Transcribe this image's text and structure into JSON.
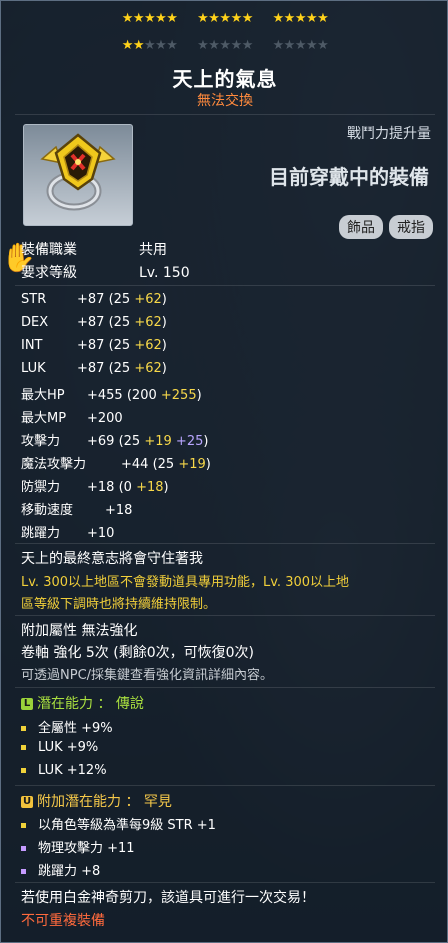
{
  "stars": {
    "row1": [
      "★★★★★",
      "★★★★★",
      "★★★★★"
    ],
    "row2_on": "★★",
    "row2_off_g1": "★★★",
    "row2_off_g2": "★★★★★",
    "row2_off_g3": "★★★★★"
  },
  "item": {
    "name": "天上的氣息",
    "tradeable": "無法交換",
    "power_label": "戰鬥力提升量",
    "wearing_label": "目前穿戴中的裝備",
    "tags": [
      "飾品",
      "戒指"
    ]
  },
  "requirements": [
    {
      "label": "裝備職業",
      "value": "共用"
    },
    {
      "label": "要求等級",
      "value": "Lv. 150"
    }
  ],
  "stats": [
    {
      "label": "STR",
      "total": "+87",
      "base": "(25",
      "bonus1": "+62",
      "bonus2": "",
      "close": ")"
    },
    {
      "label": "DEX",
      "total": "+87",
      "base": "(25",
      "bonus1": "+62",
      "bonus2": "",
      "close": ")"
    },
    {
      "label": "INT",
      "total": "+87",
      "base": "(25",
      "bonus1": "+62",
      "bonus2": "",
      "close": ")"
    },
    {
      "label": "LUK",
      "total": "+87",
      "base": "(25",
      "bonus1": "+62",
      "bonus2": "",
      "close": ")"
    },
    {
      "label": "最大HP",
      "total": "+455",
      "base": "(200",
      "bonus1": "+255",
      "bonus2": "",
      "close": ")"
    },
    {
      "label": "最大MP",
      "total": "+200",
      "base": "",
      "bonus1": "",
      "bonus2": "",
      "close": ""
    },
    {
      "label": "攻擊力",
      "total": "+69",
      "base": "(25",
      "bonus1": "+19",
      "bonus2": "+25",
      "close": ")"
    },
    {
      "label": "魔法攻擊力",
      "total": "+44",
      "base": "(25",
      "bonus1": "+19",
      "bonus2": "",
      "close": ")"
    },
    {
      "label": "防禦力",
      "total": "+18",
      "base": "(0",
      "bonus1": "+18",
      "bonus2": "",
      "close": ")"
    },
    {
      "label": "移動速度",
      "total": "+18",
      "base": "",
      "bonus1": "",
      "bonus2": "",
      "close": ""
    },
    {
      "label": "跳躍力",
      "total": "+10",
      "base": "",
      "bonus1": "",
      "bonus2": "",
      "close": ""
    }
  ],
  "description": {
    "line1": "天上的最終意志將會守住著我",
    "warn1": "Lv. 300以上地區不會發動道具專用功能，Lv. 300以上地",
    "warn2": "區等級下調時也將持續維持限制。"
  },
  "enhance": {
    "line1": "附加屬性  無法強化",
    "line2": "卷軸 強化 5次 (剩餘0次，可恢復0次)",
    "line3": "可透過NPC/採集鍵查看強化資訊詳細內容。"
  },
  "potential": {
    "badge": "L",
    "title": "潛在能力 ： 傳說",
    "lines": [
      "全屬性 +9%",
      "LUK +9%",
      "LUK +12%"
    ]
  },
  "bonus_potential": {
    "badge": "U",
    "title": "附加潛在能力 ： 罕見",
    "lines": [
      "以角色等級為準每9級 STR +1",
      "物理攻擊力 +11",
      "跳躍力 +8"
    ]
  },
  "footer": {
    "line1": "若使用白金神奇剪刀，該道具可進行一次交易！",
    "line2": "不可重複裝備"
  }
}
